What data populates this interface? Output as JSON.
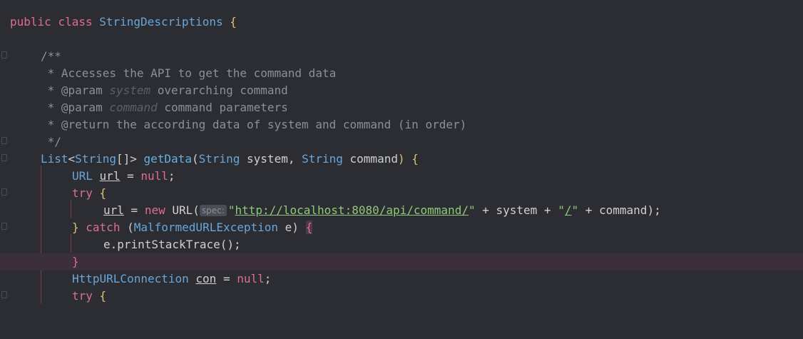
{
  "editor": {
    "lines": [
      {
        "kw1": "public",
        "kw2": "class",
        "name": "StringDescriptions",
        "brace": "{"
      },
      {},
      {
        "cmt": "/**"
      },
      {
        "cmt": " * Accesses the API to get the command data"
      },
      {
        "pre": " * @param ",
        "em": "system",
        "post": " overarching command"
      },
      {
        "pre": " * @param ",
        "em": "command",
        "post": " command parameters"
      },
      {
        "pre": " * @return ",
        "post": "the according data of system and command (in order)"
      },
      {
        "cmt": " */"
      },
      {
        "type1": "List",
        "lt": "<",
        "type2": "String",
        "arr": "[]>",
        "fn": "getData",
        "p1t": "String",
        "p1": "system",
        "p2t": "String",
        "p2": "command",
        "close": ") {"
      },
      {
        "type": "URL",
        "var": "url",
        "eq": " = ",
        "kw": "null",
        "end": ";"
      },
      {
        "kw": "try",
        "brace": "{"
      },
      {
        "var": "url",
        "eq": " = ",
        "kw": "new",
        "cls": "URL(",
        "hint": "spec:",
        "str1": "\"",
        "link": "http://localhost:8080/api/command/",
        "str2": "\"",
        "mid": " + system + ",
        "str3": "\"",
        "slash": "/",
        "str4": "\"",
        "tail": " + command);"
      },
      {
        "brace1": "}",
        "kw": "catch",
        "paren": "(",
        "type": "MalformedURLException",
        "var": "e)",
        "brace2": "{"
      },
      {
        "text": "e.printStackTrace();"
      },
      {
        "brace": "}"
      },
      {
        "type": "HttpURLConnection",
        "var": "con",
        "eq": " = ",
        "kw": "null",
        "end": ";"
      },
      {
        "kw": "try",
        "brace": "{"
      }
    ]
  }
}
